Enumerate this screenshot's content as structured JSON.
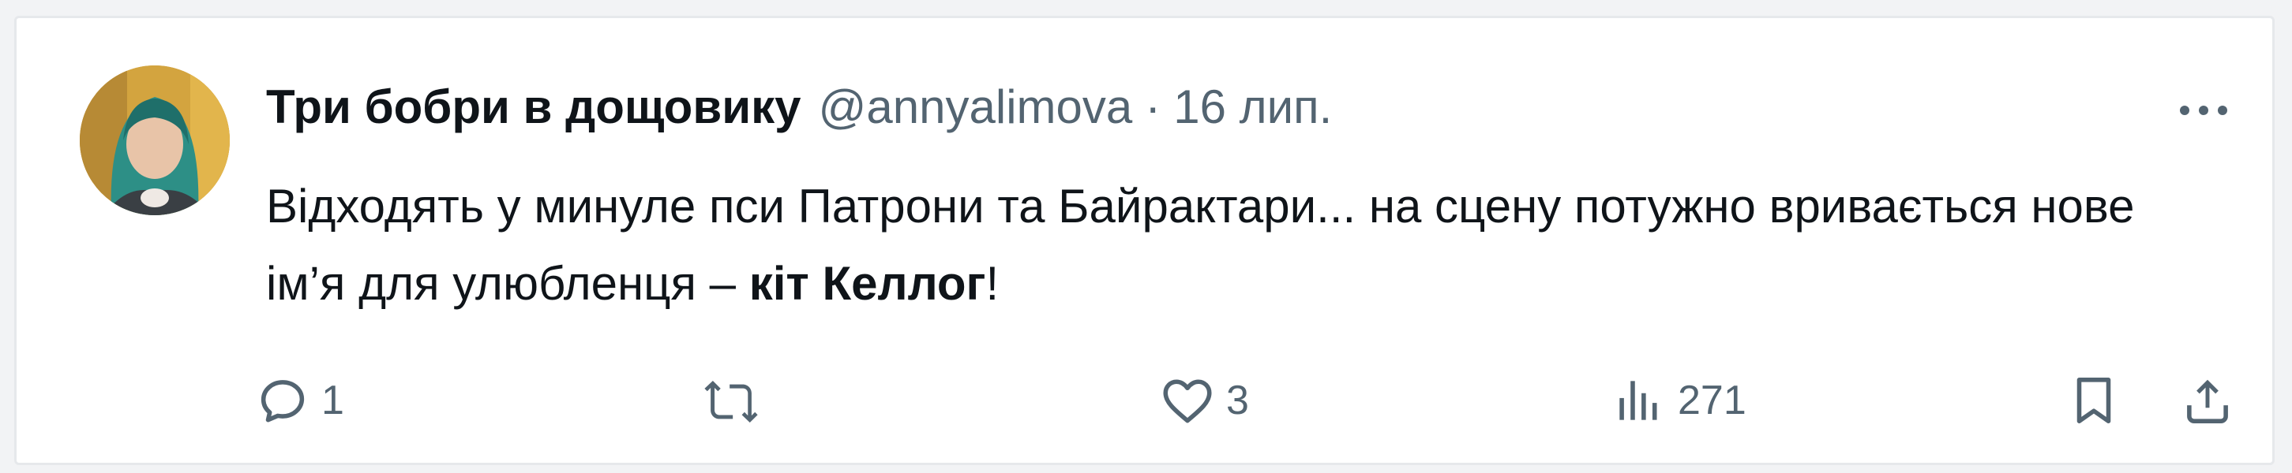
{
  "tweet": {
    "display_name": "Три бобри в дощовику",
    "handle": "@annyalimova",
    "separator": "·",
    "date": "16 лип.",
    "text_part1": "Відходять у минуле пси Патрони та Байрактари... на сцену потужно вривається нове ім’я для улюбленця – ",
    "text_bold": "кіт Келлог",
    "text_part2": "!"
  },
  "actions": {
    "replies": "1",
    "retweets": "",
    "likes": "3",
    "views": "271"
  },
  "colors": {
    "text_primary": "#0f1419",
    "text_secondary": "#536471",
    "background": "#ffffff"
  },
  "icons": [
    "more-icon",
    "reply-icon",
    "retweet-icon",
    "like-icon",
    "views-icon",
    "bookmark-icon",
    "share-icon"
  ]
}
